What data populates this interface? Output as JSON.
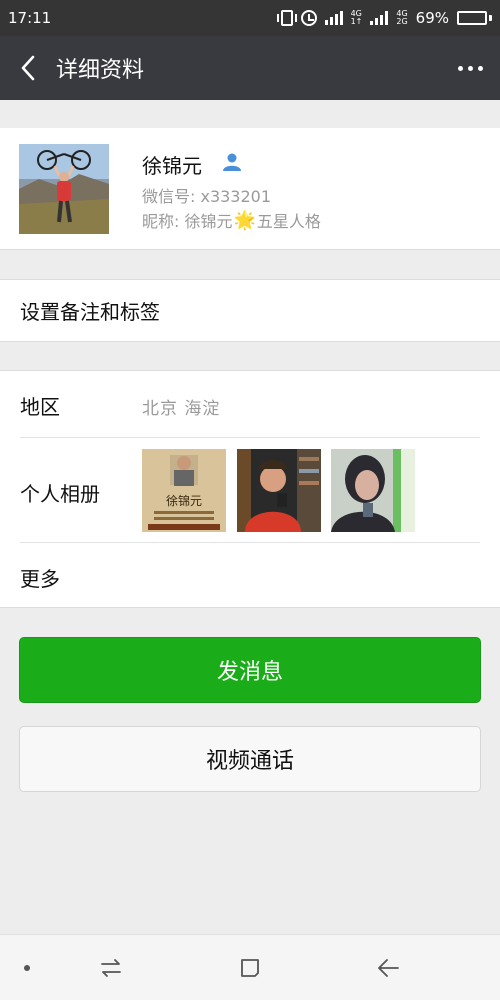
{
  "status_bar": {
    "time": "17:11",
    "network_top": "4G",
    "network_bottom": "1↑",
    "network2_top": "4G",
    "network2_bottom": "2G",
    "battery_percent": "69%",
    "battery_level": 0.69
  },
  "header": {
    "title": "详细资料",
    "back_icon": "chevron-left-icon",
    "more_icon": "more-dots-icon"
  },
  "profile": {
    "name": "徐锦元",
    "wechat_id": "微信号: x333201",
    "nickname_prefix": "昵称: 徐锦元",
    "nickname_suffix": "五星人格",
    "nickname_emoji": "🌟",
    "contact_icon": "person-icon"
  },
  "remark": {
    "label": "设置备注和标签"
  },
  "info": {
    "region_label": "地区",
    "region_value": "北京  海淀",
    "album_label": "个人相册",
    "album_thumb1_caption": "徐锦元",
    "more_label": "更多"
  },
  "actions": {
    "send_message": "发消息",
    "video_call": "视频通话"
  },
  "colors": {
    "title_bg": "#393a3f",
    "status_bg": "#353535",
    "accent_green": "#1aad19",
    "secondary_text": "#9a9a9a"
  }
}
